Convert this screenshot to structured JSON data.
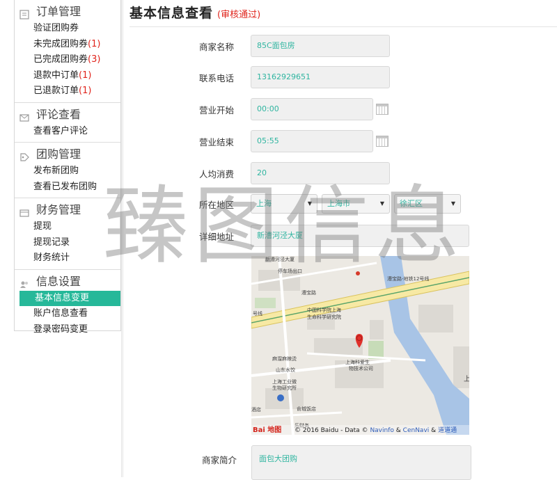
{
  "sidebar": {
    "sections": [
      {
        "title": "订单管理",
        "icon": "list-icon",
        "items": [
          {
            "label": "验证团购券",
            "count": ""
          },
          {
            "label": "未完成团购券",
            "count": "(1)"
          },
          {
            "label": "已完成团购券",
            "count": "(3)"
          },
          {
            "label": "退款中订单",
            "count": "(1)"
          },
          {
            "label": "已退款订单",
            "count": "(1)"
          }
        ]
      },
      {
        "title": "评论查看",
        "icon": "envelope-icon",
        "items": [
          {
            "label": "查看客户评论",
            "count": ""
          }
        ]
      },
      {
        "title": "团购管理",
        "icon": "tag-icon",
        "items": [
          {
            "label": "发布新团购",
            "count": ""
          },
          {
            "label": "查看已发布团购",
            "count": ""
          }
        ]
      },
      {
        "title": "财务管理",
        "icon": "wallet-icon",
        "items": [
          {
            "label": "提现",
            "count": ""
          },
          {
            "label": "提现记录",
            "count": ""
          },
          {
            "label": "财务统计",
            "count": ""
          }
        ]
      },
      {
        "title": "信息设置",
        "icon": "users-icon",
        "items": [
          {
            "label": "基本信息变更",
            "count": "",
            "active": true
          },
          {
            "label": "账户信息查看",
            "count": ""
          },
          {
            "label": "登录密码变更",
            "count": ""
          }
        ]
      }
    ]
  },
  "header": {
    "title": "基本信息查看",
    "status": "(审核通过)"
  },
  "form": {
    "name_label": "商家名称",
    "name_value": "85C面包房",
    "phone_label": "联系电话",
    "phone_value": "13162929651",
    "open_label": "营业开始",
    "open_value": "00:00",
    "close_label": "营业结束",
    "close_value": "05:55",
    "avg_label": "人均消费",
    "avg_value": "20",
    "region_label": "所在地区",
    "province": "上海",
    "city": "上海市",
    "district": "徐汇区",
    "address_label": "详细地址",
    "address_value": "新漕河泾大厦",
    "intro_label": "商家简介",
    "intro_value": "面包大团购"
  },
  "map": {
    "labels": {
      "road_top": "新漕河泾大厦",
      "parking": "停车场出口",
      "caobao_rd": "漕宝路",
      "caobao_rd_east": "漕宝路-地铁12号线",
      "line": "号线",
      "institute": "中国科学院上海",
      "institute2": "生命科学研究院",
      "malatang": "麻溜麻辣烫",
      "dumpling": "山东水饺",
      "shanghai_ind": "上海工业微",
      "shanghai_ind2": "生物研究所",
      "hotel": "酒店",
      "restaurant": "俞城饭店",
      "company": "上海科爱生",
      "company2": "物技术公司",
      "side": "上",
      "bottom_label": "乐财务"
    },
    "logo": "Bai 地图",
    "copyright": "© 2016 Baidu - Data ©",
    "copyright_navinfo": "Navinfo",
    "copyright_and1": "&",
    "copyright_cennavi": "CenNavi",
    "copyright_and2": "&",
    "copyright_daodao": "道道通"
  },
  "watermark": "臻图信息"
}
